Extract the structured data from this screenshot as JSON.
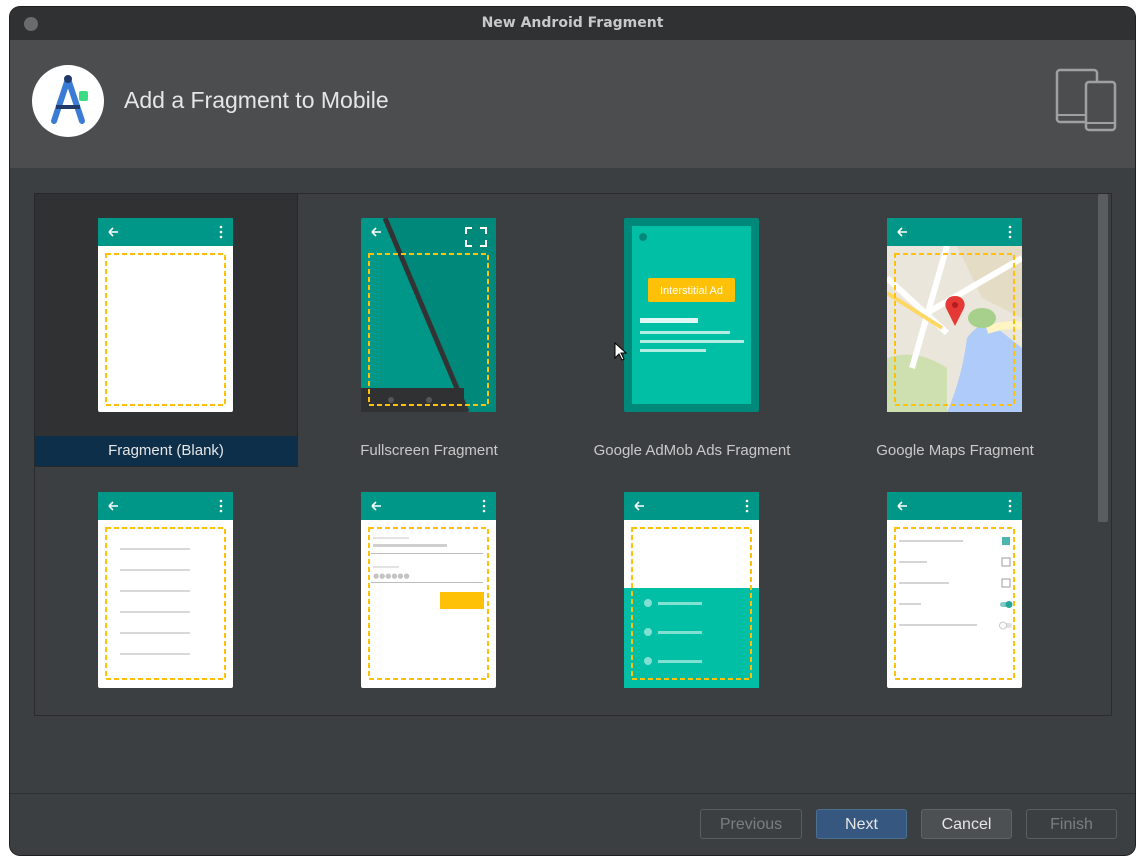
{
  "window": {
    "title": "New Android Fragment"
  },
  "header": {
    "title": "Add a Fragment to Mobile"
  },
  "templates": [
    {
      "label": "Fragment (Blank)",
      "selected": true
    },
    {
      "label": "Fullscreen Fragment",
      "selected": false
    },
    {
      "label": "Google AdMob Ads Fragment",
      "selected": false,
      "badge": "Interstitial Ad"
    },
    {
      "label": "Google Maps Fragment",
      "selected": false
    }
  ],
  "buttons": {
    "previous": "Previous",
    "next": "Next",
    "cancel": "Cancel",
    "finish": "Finish"
  },
  "colors": {
    "teal_dark": "#009688",
    "teal": "#00bfa5",
    "accent_yellow": "#ffc107",
    "primary_button": "#365880",
    "selection": "#0e2f4a"
  }
}
